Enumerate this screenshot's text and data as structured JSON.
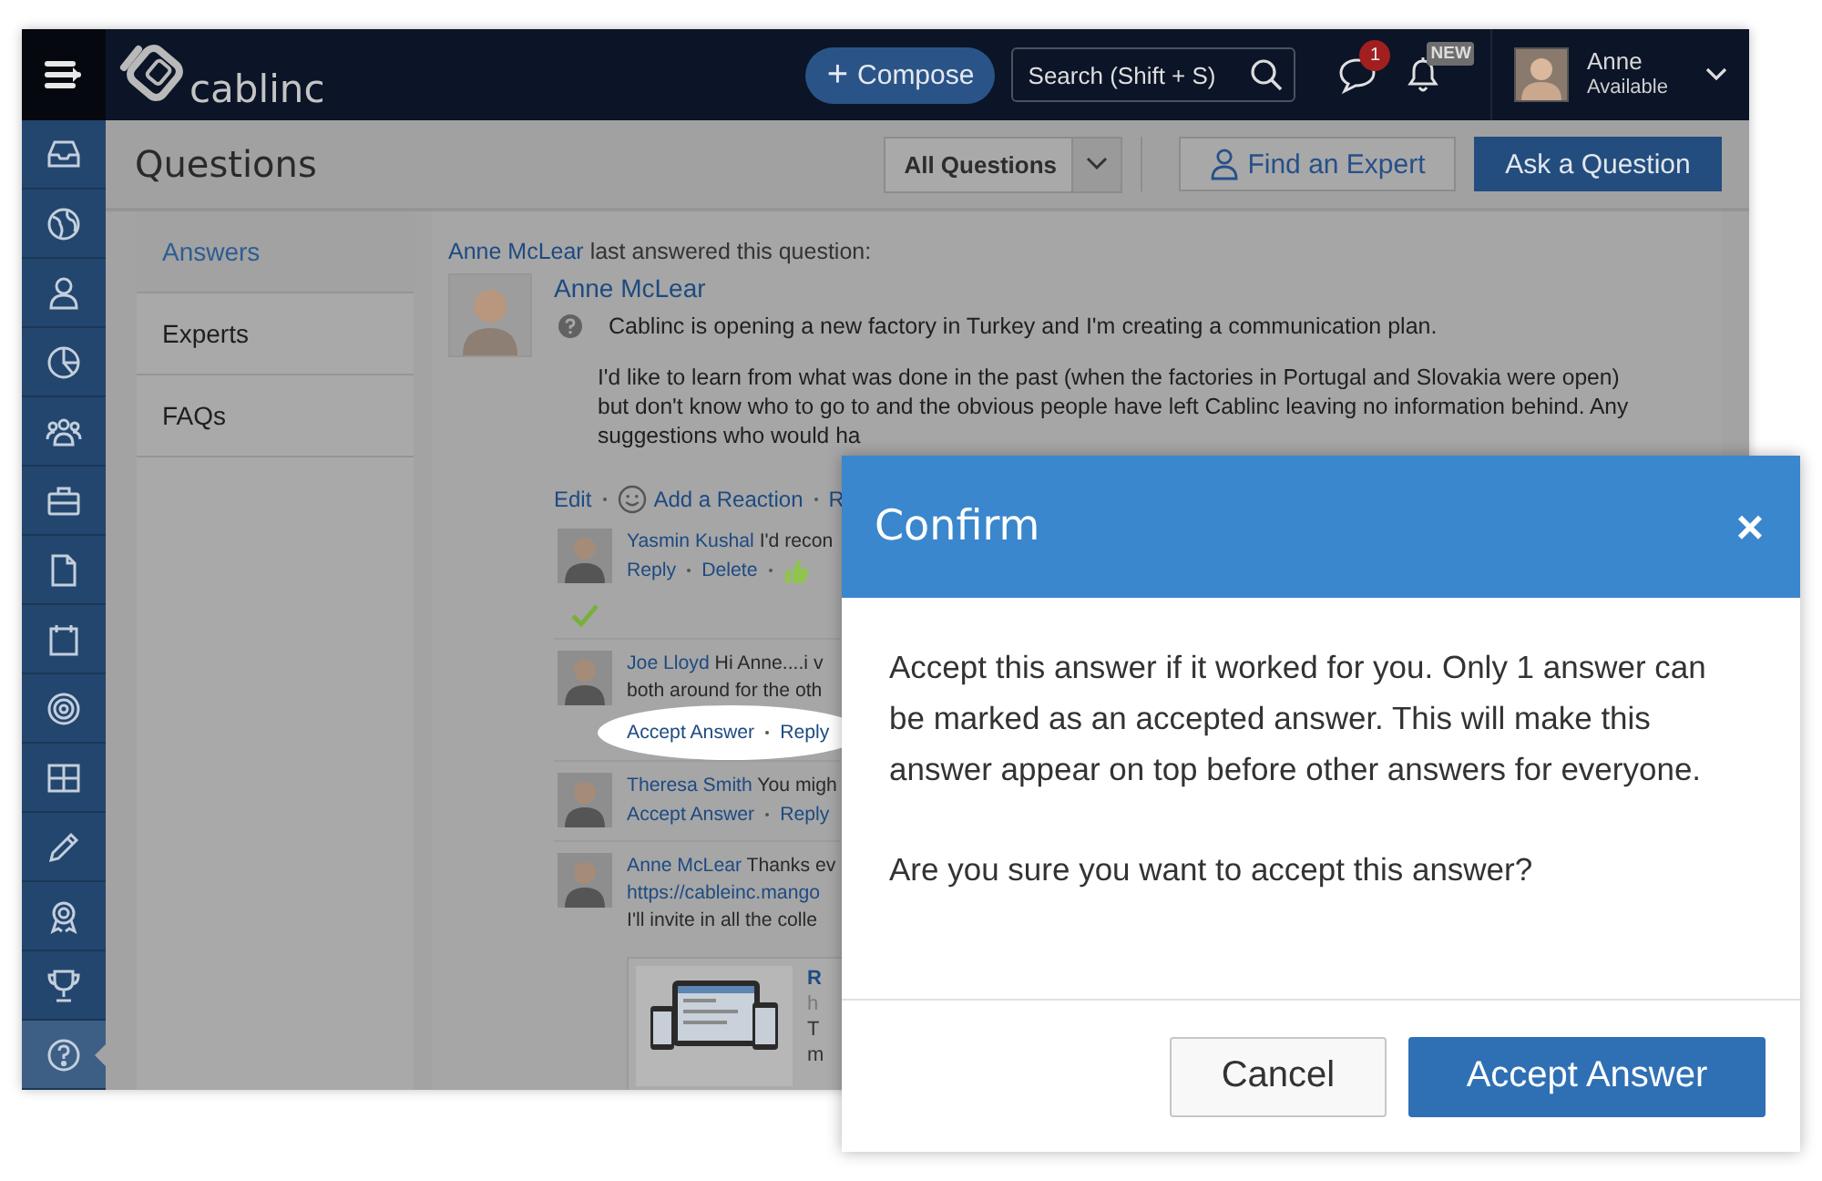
{
  "header": {
    "logo": "cablinc",
    "compose": {
      "icon": "+",
      "label": "Compose"
    },
    "search": {
      "placeholder": "Search (Shift + S)"
    },
    "chat_badge": "1",
    "notification_badge": "NEW",
    "user": {
      "name": "Anne",
      "status": "Available"
    }
  },
  "nav": [
    {
      "kind": "inbox",
      "selected": false
    },
    {
      "kind": "globe",
      "selected": false
    },
    {
      "kind": "person",
      "selected": false
    },
    {
      "kind": "pie",
      "selected": false
    },
    {
      "kind": "group",
      "selected": false
    },
    {
      "kind": "briefcase",
      "selected": false
    },
    {
      "kind": "document",
      "selected": false
    },
    {
      "kind": "calendar",
      "selected": false
    },
    {
      "kind": "target",
      "selected": false
    },
    {
      "kind": "grid",
      "selected": false
    },
    {
      "kind": "pencil",
      "selected": false
    },
    {
      "kind": "award",
      "selected": false
    },
    {
      "kind": "trophy",
      "selected": false
    },
    {
      "kind": "help",
      "selected": true
    }
  ],
  "page": {
    "title": "Questions",
    "filter": {
      "value": "All Questions"
    },
    "buttons": [
      {
        "kind": "outline",
        "label": "Find an Expert"
      },
      {
        "kind": "primary",
        "label": "Ask a Question"
      }
    ]
  },
  "subnav": [
    {
      "label": "Answers",
      "selected": true
    },
    {
      "label": "Experts",
      "selected": false
    },
    {
      "label": "FAQs",
      "selected": false
    }
  ],
  "question": {
    "last_answer_by": "Anne McLear",
    "last_answer_note": "last answered this question:",
    "author": "Anne McLear",
    "title": "Cablinc is opening a new factory in Turkey and I'm creating a communication plan.",
    "body_lines": [
      "I'd like to learn from what was done in the past (when the factories in Portugal and Slovakia were open)",
      "but don't know who to go to and the obvious people have left Cablinc leaving no information behind. Any",
      "suggestions who would ha"
    ],
    "actions": [
      {
        "kind": "link",
        "label": "Edit"
      },
      {
        "kind": "reaction",
        "label": "Add a Reaction"
      },
      {
        "kind": "link",
        "label": "R"
      }
    ]
  },
  "answers": [
    {
      "author": "Yasmin Kushal",
      "lines": [
        {
          "kind": "text",
          "text": "I'd recon"
        }
      ],
      "actions": [
        {
          "kind": "link",
          "label": "Reply"
        },
        {
          "kind": "link",
          "label": "Delete"
        },
        {
          "kind": "like"
        }
      ],
      "accepted": true,
      "highlighted": false
    },
    {
      "author": "Joe Lloyd",
      "lines": [
        {
          "kind": "text",
          "text": "Hi Anne....i v"
        },
        {
          "kind": "text",
          "text": "both around for the oth"
        }
      ],
      "actions": [
        {
          "kind": "link",
          "label": "Accept Answer"
        },
        {
          "kind": "link",
          "label": "Reply"
        }
      ],
      "accepted": false,
      "highlighted": true
    },
    {
      "author": "Theresa Smith",
      "lines": [
        {
          "kind": "text",
          "text": "You migh"
        }
      ],
      "actions": [
        {
          "kind": "link",
          "label": "Accept Answer"
        },
        {
          "kind": "link",
          "label": "Reply"
        }
      ],
      "accepted": false,
      "highlighted": false
    },
    {
      "author": "Anne McLear",
      "lines": [
        {
          "kind": "text",
          "text": "Thanks ev"
        },
        {
          "kind": "link",
          "text": "https://cableinc.mango"
        },
        {
          "kind": "text",
          "text": "I'll invite in all the colle"
        }
      ],
      "preview": {
        "kind": "picture",
        "title": "R",
        "lines": [
          "h",
          "T",
          "m"
        ]
      },
      "accepted": false,
      "highlighted": false
    }
  ],
  "dialog": {
    "title": "Confirm",
    "close": "×",
    "message": "Accept this answer if it worked for you. Only 1 answer can be marked as an accepted answer. This will make this answer appear on top before other answers for everyone.",
    "question": "Are you sure you want to accept this answer?",
    "buttons": [
      {
        "kind": "secondary",
        "label": "Cancel"
      },
      {
        "kind": "primary",
        "label": "Accept Answer"
      }
    ]
  }
}
